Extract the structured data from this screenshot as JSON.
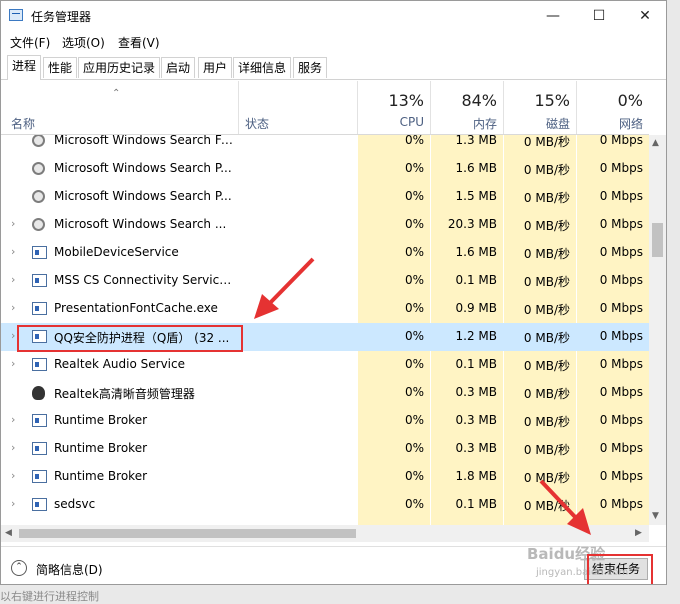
{
  "window": {
    "title": "任务管理器",
    "controls": [
      "—",
      "☐",
      "✕"
    ]
  },
  "menu": [
    "文件(F)",
    "选项(O)",
    "查看(V)"
  ],
  "tabs": [
    "进程",
    "性能",
    "应用历史记录",
    "启动",
    "用户",
    "详细信息",
    "服务"
  ],
  "active_tab": "进程",
  "columns": {
    "name": "名称",
    "status": "状态",
    "cpu": {
      "percent": "13%",
      "label": "CPU"
    },
    "memory": {
      "percent": "84%",
      "label": "内存"
    },
    "disk": {
      "percent": "15%",
      "label": "磁盘"
    },
    "network": {
      "percent": "0%",
      "label": "网络"
    }
  },
  "rows": [
    {
      "name": "Microsoft Windows Search Fi...",
      "icon": "search-user-icon",
      "cpu": "0%",
      "mem": "1.3 MB",
      "disk": "0 MB/秒",
      "net": "0 Mbps",
      "expand": false
    },
    {
      "name": "Microsoft Windows Search P...",
      "icon": "search-user-icon",
      "cpu": "0%",
      "mem": "1.6 MB",
      "disk": "0 MB/秒",
      "net": "0 Mbps",
      "expand": false
    },
    {
      "name": "Microsoft Windows Search P...",
      "icon": "search-user-icon",
      "cpu": "0%",
      "mem": "1.5 MB",
      "disk": "0 MB/秒",
      "net": "0 Mbps",
      "expand": false
    },
    {
      "name": "Microsoft Windows Search ...",
      "icon": "search-user-icon",
      "cpu": "0%",
      "mem": "20.3 MB",
      "disk": "0 MB/秒",
      "net": "0 Mbps",
      "expand": true
    },
    {
      "name": "MobileDeviceService",
      "icon": "service-icon",
      "cpu": "0%",
      "mem": "1.6 MB",
      "disk": "0 MB/秒",
      "net": "0 Mbps",
      "expand": true
    },
    {
      "name": "MSS CS Connectivity Service ...",
      "icon": "service-icon",
      "cpu": "0%",
      "mem": "0.1 MB",
      "disk": "0 MB/秒",
      "net": "0 Mbps",
      "expand": true
    },
    {
      "name": "PresentationFontCache.exe",
      "icon": "service-icon",
      "cpu": "0%",
      "mem": "0.9 MB",
      "disk": "0 MB/秒",
      "net": "0 Mbps",
      "expand": true
    },
    {
      "name": "QQ安全防护进程（Q盾） (32 ...",
      "icon": "service-icon",
      "cpu": "0%",
      "mem": "1.2 MB",
      "disk": "0 MB/秒",
      "net": "0 Mbps",
      "expand": true,
      "selected": true
    },
    {
      "name": "Realtek Audio Service",
      "icon": "service-icon",
      "cpu": "0%",
      "mem": "0.1 MB",
      "disk": "0 MB/秒",
      "net": "0 Mbps",
      "expand": true
    },
    {
      "name": "Realtek高清晰音频管理器",
      "icon": "audio-icon",
      "cpu": "0%",
      "mem": "0.3 MB",
      "disk": "0 MB/秒",
      "net": "0 Mbps",
      "expand": false
    },
    {
      "name": "Runtime Broker",
      "icon": "service-icon",
      "cpu": "0%",
      "mem": "0.3 MB",
      "disk": "0 MB/秒",
      "net": "0 Mbps",
      "expand": true
    },
    {
      "name": "Runtime Broker",
      "icon": "service-icon",
      "cpu": "0%",
      "mem": "0.3 MB",
      "disk": "0 MB/秒",
      "net": "0 Mbps",
      "expand": true
    },
    {
      "name": "Runtime Broker",
      "icon": "service-icon",
      "cpu": "0%",
      "mem": "1.8 MB",
      "disk": "0 MB/秒",
      "net": "0 Mbps",
      "expand": true
    },
    {
      "name": "sedsvc",
      "icon": "service-icon",
      "cpu": "0%",
      "mem": "0.1 MB",
      "disk": "0 MB/秒",
      "net": "0 Mbps",
      "expand": true
    }
  ],
  "footer": {
    "fewer_details": "简略信息(D)",
    "end_task": "结束任务(E)"
  },
  "watermark": {
    "line1": "Baidu经验",
    "line2": "jingyan.baidu.com"
  },
  "bottom_caption": "以右键进行进程控制"
}
